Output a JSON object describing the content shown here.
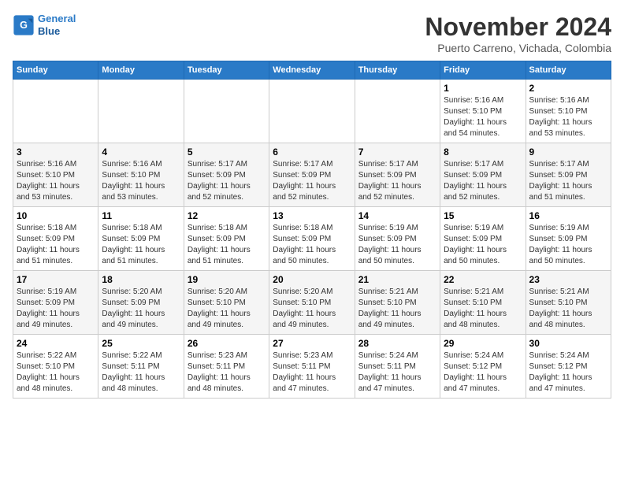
{
  "header": {
    "logo_line1": "General",
    "logo_line2": "Blue",
    "month_title": "November 2024",
    "location": "Puerto Carreno, Vichada, Colombia"
  },
  "days_of_week": [
    "Sunday",
    "Monday",
    "Tuesday",
    "Wednesday",
    "Thursday",
    "Friday",
    "Saturday"
  ],
  "weeks": [
    [
      {
        "num": "",
        "info": ""
      },
      {
        "num": "",
        "info": ""
      },
      {
        "num": "",
        "info": ""
      },
      {
        "num": "",
        "info": ""
      },
      {
        "num": "",
        "info": ""
      },
      {
        "num": "1",
        "info": "Sunrise: 5:16 AM\nSunset: 5:10 PM\nDaylight: 11 hours\nand 54 minutes."
      },
      {
        "num": "2",
        "info": "Sunrise: 5:16 AM\nSunset: 5:10 PM\nDaylight: 11 hours\nand 53 minutes."
      }
    ],
    [
      {
        "num": "3",
        "info": "Sunrise: 5:16 AM\nSunset: 5:10 PM\nDaylight: 11 hours\nand 53 minutes."
      },
      {
        "num": "4",
        "info": "Sunrise: 5:16 AM\nSunset: 5:10 PM\nDaylight: 11 hours\nand 53 minutes."
      },
      {
        "num": "5",
        "info": "Sunrise: 5:17 AM\nSunset: 5:09 PM\nDaylight: 11 hours\nand 52 minutes."
      },
      {
        "num": "6",
        "info": "Sunrise: 5:17 AM\nSunset: 5:09 PM\nDaylight: 11 hours\nand 52 minutes."
      },
      {
        "num": "7",
        "info": "Sunrise: 5:17 AM\nSunset: 5:09 PM\nDaylight: 11 hours\nand 52 minutes."
      },
      {
        "num": "8",
        "info": "Sunrise: 5:17 AM\nSunset: 5:09 PM\nDaylight: 11 hours\nand 52 minutes."
      },
      {
        "num": "9",
        "info": "Sunrise: 5:17 AM\nSunset: 5:09 PM\nDaylight: 11 hours\nand 51 minutes."
      }
    ],
    [
      {
        "num": "10",
        "info": "Sunrise: 5:18 AM\nSunset: 5:09 PM\nDaylight: 11 hours\nand 51 minutes."
      },
      {
        "num": "11",
        "info": "Sunrise: 5:18 AM\nSunset: 5:09 PM\nDaylight: 11 hours\nand 51 minutes."
      },
      {
        "num": "12",
        "info": "Sunrise: 5:18 AM\nSunset: 5:09 PM\nDaylight: 11 hours\nand 51 minutes."
      },
      {
        "num": "13",
        "info": "Sunrise: 5:18 AM\nSunset: 5:09 PM\nDaylight: 11 hours\nand 50 minutes."
      },
      {
        "num": "14",
        "info": "Sunrise: 5:19 AM\nSunset: 5:09 PM\nDaylight: 11 hours\nand 50 minutes."
      },
      {
        "num": "15",
        "info": "Sunrise: 5:19 AM\nSunset: 5:09 PM\nDaylight: 11 hours\nand 50 minutes."
      },
      {
        "num": "16",
        "info": "Sunrise: 5:19 AM\nSunset: 5:09 PM\nDaylight: 11 hours\nand 50 minutes."
      }
    ],
    [
      {
        "num": "17",
        "info": "Sunrise: 5:19 AM\nSunset: 5:09 PM\nDaylight: 11 hours\nand 49 minutes."
      },
      {
        "num": "18",
        "info": "Sunrise: 5:20 AM\nSunset: 5:09 PM\nDaylight: 11 hours\nand 49 minutes."
      },
      {
        "num": "19",
        "info": "Sunrise: 5:20 AM\nSunset: 5:10 PM\nDaylight: 11 hours\nand 49 minutes."
      },
      {
        "num": "20",
        "info": "Sunrise: 5:20 AM\nSunset: 5:10 PM\nDaylight: 11 hours\nand 49 minutes."
      },
      {
        "num": "21",
        "info": "Sunrise: 5:21 AM\nSunset: 5:10 PM\nDaylight: 11 hours\nand 49 minutes."
      },
      {
        "num": "22",
        "info": "Sunrise: 5:21 AM\nSunset: 5:10 PM\nDaylight: 11 hours\nand 48 minutes."
      },
      {
        "num": "23",
        "info": "Sunrise: 5:21 AM\nSunset: 5:10 PM\nDaylight: 11 hours\nand 48 minutes."
      }
    ],
    [
      {
        "num": "24",
        "info": "Sunrise: 5:22 AM\nSunset: 5:10 PM\nDaylight: 11 hours\nand 48 minutes."
      },
      {
        "num": "25",
        "info": "Sunrise: 5:22 AM\nSunset: 5:11 PM\nDaylight: 11 hours\nand 48 minutes."
      },
      {
        "num": "26",
        "info": "Sunrise: 5:23 AM\nSunset: 5:11 PM\nDaylight: 11 hours\nand 48 minutes."
      },
      {
        "num": "27",
        "info": "Sunrise: 5:23 AM\nSunset: 5:11 PM\nDaylight: 11 hours\nand 47 minutes."
      },
      {
        "num": "28",
        "info": "Sunrise: 5:24 AM\nSunset: 5:11 PM\nDaylight: 11 hours\nand 47 minutes."
      },
      {
        "num": "29",
        "info": "Sunrise: 5:24 AM\nSunset: 5:12 PM\nDaylight: 11 hours\nand 47 minutes."
      },
      {
        "num": "30",
        "info": "Sunrise: 5:24 AM\nSunset: 5:12 PM\nDaylight: 11 hours\nand 47 minutes."
      }
    ]
  ]
}
